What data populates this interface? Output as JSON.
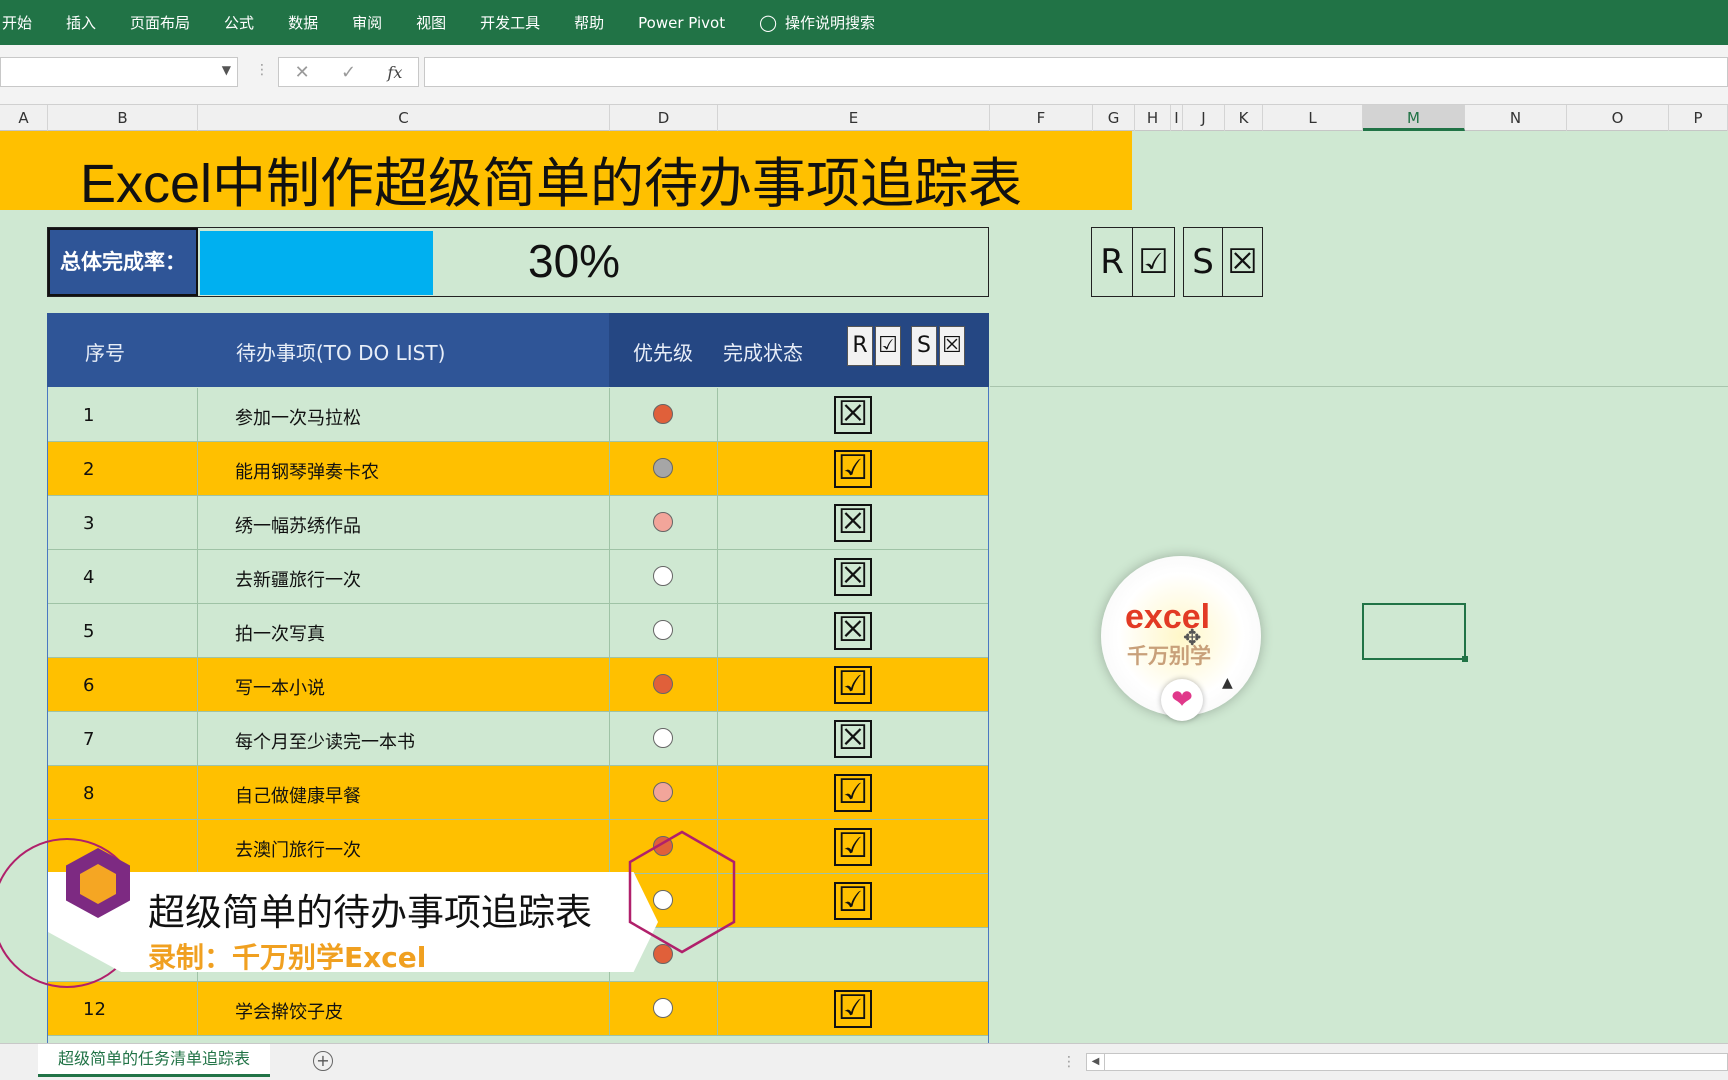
{
  "ribbon": {
    "tabs": [
      "开始",
      "插入",
      "页面布局",
      "公式",
      "数据",
      "审阅",
      "视图",
      "开发工具",
      "帮助",
      "Power Pivot"
    ],
    "search_label": "操作说明搜索",
    "bulb_icon": "lightbulb-icon"
  },
  "formula_bar": {
    "name_box_value": "",
    "cancel_glyph": "✕",
    "enter_glyph": "✓",
    "fx_label": "fx",
    "formula_value": ""
  },
  "columns": [
    "A",
    "B",
    "C",
    "D",
    "E",
    "F",
    "G",
    "H",
    "I",
    "J",
    "K",
    "L",
    "M",
    "N",
    "O",
    "P"
  ],
  "selected_column": "M",
  "sheet": {
    "title": "Excel中制作超级简单的待办事项追踪表",
    "rate_label": "总体完成率：",
    "rate_percent": "30%",
    "rate_fraction": 0.3,
    "glyph_legend": [
      "R",
      "☑",
      "S",
      "☒"
    ],
    "table_headers": {
      "seq": "序号",
      "todo": "待办事项(TO DO LIST)",
      "priority": "优先级",
      "status": "完成状态",
      "mini_legend": [
        "R",
        "☑",
        "S",
        "☒"
      ]
    },
    "rows": [
      {
        "num": "1",
        "task": "参加一次马拉松",
        "priority_color": "#e0603a",
        "status": "☒",
        "band": "green"
      },
      {
        "num": "2",
        "task": "能用钢琴弹奏卡农",
        "priority_color": "#a6a6a6",
        "status": "☑",
        "band": "orange"
      },
      {
        "num": "3",
        "task": "绣一幅苏绣作品",
        "priority_color": "#f2a59a",
        "status": "☒",
        "band": "green"
      },
      {
        "num": "4",
        "task": "去新疆旅行一次",
        "priority_color": "#ffffff",
        "status": "☒",
        "band": "green"
      },
      {
        "num": "5",
        "task": "拍一次写真",
        "priority_color": "#ffffff",
        "status": "☒",
        "band": "green"
      },
      {
        "num": "6",
        "task": "写一本小说",
        "priority_color": "#e0603a",
        "status": "☑",
        "band": "orange"
      },
      {
        "num": "7",
        "task": "每个月至少读完一本书",
        "priority_color": "#ffffff",
        "status": "☒",
        "band": "green"
      },
      {
        "num": "8",
        "task": "自己做健康早餐",
        "priority_color": "#f2a59a",
        "status": "☑",
        "band": "orange"
      },
      {
        "num": "",
        "task": "去澳门旅行一次",
        "priority_color": "#e0603a",
        "status": "☑",
        "band": "orange"
      },
      {
        "num": "",
        "task": "",
        "priority_color": "#ffffff",
        "status": "☑",
        "band": "orange"
      },
      {
        "num": "",
        "task": "",
        "priority_color": "#e0603a",
        "status": "",
        "band": "green"
      },
      {
        "num": "12",
        "task": "学会擀饺子皮",
        "priority_color": "#ffffff",
        "status": "☑",
        "band": "orange"
      }
    ]
  },
  "badge": {
    "line1": "excel",
    "line2": "千万别学",
    "heart": "❤"
  },
  "overlay_caption": {
    "title": "超级简单的待办事项追踪表",
    "subtitle": "录制：千万别学Excel"
  },
  "sheet_tabs": {
    "active": "超级简单的任务清单追踪表",
    "add_glyph": "+"
  },
  "colors": {
    "ribbon": "#217346",
    "title_band": "#ffc000",
    "header_blue": "#2f5597",
    "progress": "#00b0f0",
    "row_green": "#cfe8d2",
    "row_orange": "#ffc000"
  }
}
